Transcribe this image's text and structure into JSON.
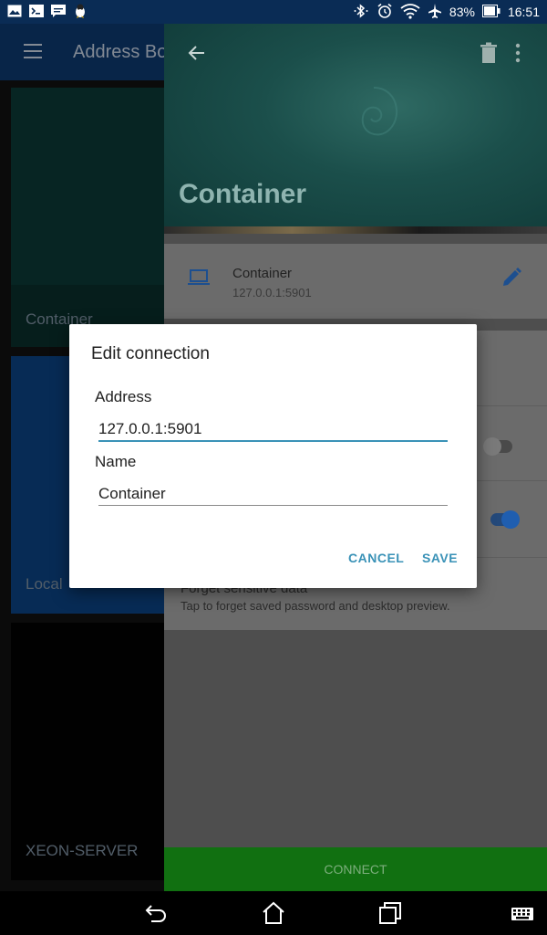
{
  "status_bar": {
    "battery": "83%",
    "time": "16:51",
    "left_icons": [
      "image-icon",
      "terminal-icon",
      "message-icon",
      "linux-icon"
    ],
    "right_icons": [
      "bluetooth-icon",
      "alarm-icon",
      "wifi-icon",
      "airplane-icon",
      "battery-icon"
    ]
  },
  "address_book": {
    "title": "Address Bo",
    "cards": [
      {
        "label": "Container"
      },
      {
        "label": "Local"
      },
      {
        "label": "XEON-SERVER"
      }
    ]
  },
  "detail": {
    "title": "Container",
    "connection": {
      "name": "Container",
      "address": "127.0.0.1:5901"
    },
    "forget": {
      "title": "Forget sensitive data",
      "subtitle": "Tap to forget saved password and desktop preview."
    },
    "toggles": [
      {
        "state": "off"
      },
      {
        "state": "on"
      }
    ],
    "connect_label": "CONNECT"
  },
  "dialog": {
    "title": "Edit connection",
    "address_label": "Address",
    "address_value": "127.0.0.1:5901",
    "name_label": "Name",
    "name_value": "Container",
    "cancel_label": "CANCEL",
    "save_label": "SAVE"
  },
  "colors": {
    "accent": "#3a92b7",
    "connect_green": "#117011",
    "toolbar_blue": "#0d3a6f"
  }
}
